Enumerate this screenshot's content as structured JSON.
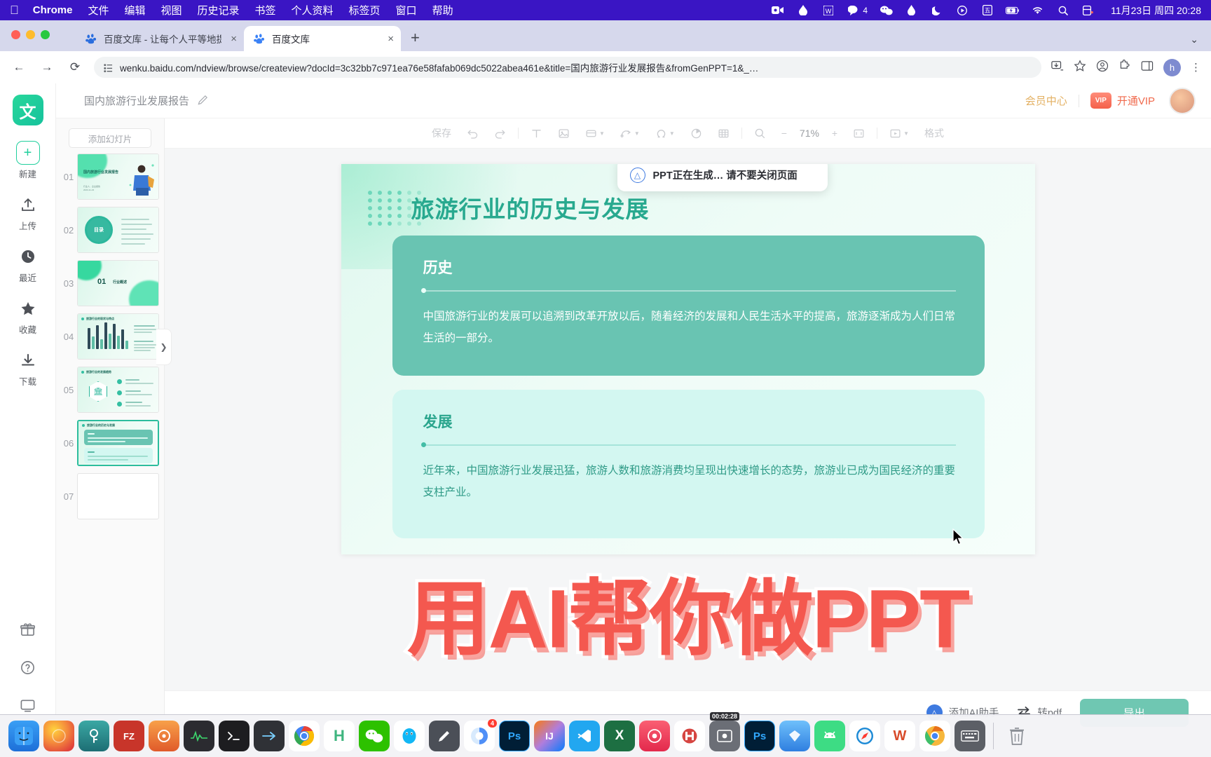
{
  "macbar": {
    "apple_icon": "apple-logo-icon",
    "items": [
      "Chrome",
      "文件",
      "编辑",
      "视图",
      "历史记录",
      "书签",
      "个人资料",
      "标签页",
      "窗口",
      "帮助"
    ],
    "tray": [
      {
        "name": "camera-recorder-icon"
      },
      {
        "name": "drop-icon"
      },
      {
        "name": "wolfram-w-icon"
      },
      {
        "name": "chat-bubble-icon",
        "badge": "4"
      },
      {
        "name": "wechat-icon"
      },
      {
        "name": "water-drop-icon"
      },
      {
        "name": "moon-icon"
      },
      {
        "name": "play-circle-icon"
      },
      {
        "name": "input-method-icon"
      },
      {
        "name": "battery-charging-icon"
      },
      {
        "name": "wifi-icon"
      },
      {
        "name": "spotlight-search-icon"
      },
      {
        "name": "control-center-icon"
      }
    ],
    "clock": "11月23日 周四 20:28"
  },
  "browser": {
    "tabs": [
      {
        "title": "百度文库 - 让每个人平等地提升",
        "active": false,
        "favicon": "baidu-paw-icon",
        "close": "×"
      },
      {
        "title": "百度文库",
        "active": true,
        "favicon": "baidu-paw-icon",
        "close": "×"
      }
    ],
    "new_tab_label": "+",
    "tabstrip_chevron": "⌄",
    "nav": {
      "back": "←",
      "forward": "→",
      "reload": "⟳"
    },
    "url": "wenku.baidu.com/ndview/browse/createview?docId=3c32bb7c971ea76e58fafab069dc5022abea461e&title=国内旅游行业发展报告&fromGenPPT=1&_…",
    "url_prefix_icon": "site-settings-icon",
    "right_icons": [
      "install-app-icon",
      "bookmark-star-icon",
      "profile-circle-icon",
      "extensions-icon",
      "side-panel-icon"
    ],
    "profile_initial": "h",
    "menu_icon": "kebab-menu-icon"
  },
  "app": {
    "logo_char": "文",
    "doc_title": "国内旅游行业发展报告",
    "edit_icon": "pencil-icon",
    "member_center": "会员中心",
    "vip_badge": "VIP",
    "open_vip": "开通VIP"
  },
  "rail": {
    "items": [
      {
        "label": "新建",
        "icon": "plus-icon",
        "glyph": "+"
      },
      {
        "label": "上传",
        "icon": "upload-icon",
        "glyph": "⬆"
      },
      {
        "label": "最近",
        "icon": "clock-icon",
        "glyph": "🕐"
      },
      {
        "label": "收藏",
        "icon": "star-icon",
        "glyph": "★"
      },
      {
        "label": "下载",
        "icon": "download-icon",
        "glyph": "⬇"
      }
    ],
    "bottom": [
      {
        "icon": "gift-icon",
        "glyph": "🎁"
      },
      {
        "icon": "help-circle-icon",
        "glyph": "?"
      },
      {
        "icon": "monitor-icon",
        "glyph": "🖥"
      }
    ]
  },
  "thumbnails": {
    "add_slide_label": "添加幻灯片",
    "collapse_chevron": "❯",
    "slides": [
      {
        "num": "01",
        "kind": "cover",
        "title": "国内旅游行业发展报告",
        "selected": false
      },
      {
        "num": "02",
        "kind": "toc",
        "title": "目录",
        "selected": false
      },
      {
        "num": "03",
        "kind": "section",
        "title": "01 行业概述",
        "selected": false
      },
      {
        "num": "04",
        "kind": "chart",
        "title": "旅游行业的现状与特点",
        "selected": false
      },
      {
        "num": "05",
        "kind": "icons",
        "title": "旅游行业的发展趋势",
        "selected": false
      },
      {
        "num": "06",
        "kind": "cards",
        "title": "旅游行业的历史与发展",
        "selected": true
      },
      {
        "num": "07",
        "kind": "blank",
        "title": "",
        "selected": false
      }
    ]
  },
  "toolbar": {
    "save_label": "保存",
    "undo_icon": "undo-icon",
    "redo_icon": "redo-icon",
    "text_icon": "text-T-icon",
    "image_icon": "image-icon",
    "shape_icon": "shape-icon",
    "connector_icon": "connector-icon",
    "symbol_icon": "omega-symbol-icon",
    "chart_icon": "pie-chart-icon",
    "table_icon": "table-icon",
    "search_icon": "search-icon",
    "zoom_out": "−",
    "zoom_value": "71%",
    "zoom_in": "+",
    "fit_icon": "fit-screen-icon",
    "present_icon": "present-icon",
    "format_label": "格式"
  },
  "toast": {
    "icon": "ai-triangle-icon",
    "text": "PPT正在生成… 请不要关闭页面"
  },
  "slide": {
    "title": "旅游行业的历史与发展",
    "cards": [
      {
        "heading": "历史",
        "body": "中国旅游行业的发展可以追溯到改革开放以后，随着经济的发展和人民生活水平的提高，旅游逐渐成为人们日常生活的一部分。"
      },
      {
        "heading": "发展",
        "body": "近年来，中国旅游行业发展迅猛，旅游人数和旅游消费均呈现出快速增长的态势，旅游业已成为国民经济的重要支柱产业。"
      }
    ]
  },
  "watermark": "用AI帮你做PPT",
  "bottombar": {
    "ai_assistant": "添加AI助手",
    "ai_icon": "ai-triangle-icon",
    "convert_pdf": "转pdf",
    "convert_icon": "swap-arrows-icon",
    "export": "导出"
  },
  "dock": {
    "apps": [
      {
        "name": "finder",
        "glyph": "◉",
        "color": "#3a9ff5"
      },
      {
        "name": "firefox",
        "glyph": "🦊",
        "color": "#f4893c"
      },
      {
        "name": "keychain",
        "glyph": "◆",
        "color": "#2f8f8d"
      },
      {
        "name": "filezilla",
        "glyph": "FZ",
        "color": "#c8352a"
      },
      {
        "name": "safari-tech",
        "glyph": "◎",
        "color": "#e86a33"
      },
      {
        "name": "activity-monitor",
        "glyph": "∿",
        "color": "#2b2b30"
      },
      {
        "name": "terminal",
        "glyph": ">_",
        "color": "#1d1d20"
      },
      {
        "name": "shuttle",
        "glyph": "➤",
        "color": "#2f3136"
      },
      {
        "name": "chrome",
        "glyph": "◉",
        "color": "#4285f4"
      },
      {
        "name": "highlight-h",
        "glyph": "H",
        "color": "#3fb57f"
      },
      {
        "name": "wechat",
        "glyph": "💬",
        "color": "#2dc100"
      },
      {
        "name": "qq",
        "glyph": "🐧",
        "color": "#12b7f5"
      },
      {
        "name": "notes",
        "glyph": "✎",
        "color": "#4b4f57"
      },
      {
        "name": "preview",
        "glyph": "◐",
        "color": "#4f8ff7",
        "badge": "4"
      },
      {
        "name": "photoshop",
        "glyph": "PS",
        "color": "#001e36"
      },
      {
        "name": "intellij-idea",
        "glyph": "IJ",
        "color": "#2b2b31"
      },
      {
        "name": "vscode",
        "glyph": "✖",
        "color": "#22a7f0"
      },
      {
        "name": "excel",
        "glyph": "X",
        "color": "#1d6f42"
      },
      {
        "name": "xmind",
        "glyph": "◍",
        "color": "#e34a6f"
      },
      {
        "name": "handbrake",
        "glyph": "⦀",
        "color": "#d64541"
      },
      {
        "name": "screen-recorder",
        "glyph": "▣",
        "color": "#6b6e76",
        "timer": "00:02:28"
      },
      {
        "name": "photoshop-2",
        "glyph": "PS",
        "color": "#001e36"
      },
      {
        "name": "sketch",
        "glyph": "◈",
        "color": "#4a90e2"
      },
      {
        "name": "android-studio",
        "glyph": "🤖",
        "color": "#3ddc84"
      },
      {
        "name": "safari",
        "glyph": "⊙",
        "color": "#1c8ad6"
      },
      {
        "name": "wps",
        "glyph": "W",
        "color": "#d84b2a"
      },
      {
        "name": "chrome-canary",
        "glyph": "◉",
        "color": "#f6b73c"
      },
      {
        "name": "keyboard-settings",
        "glyph": "⌨",
        "color": "#5c5f66"
      },
      {
        "name": "trash",
        "glyph": "🗑",
        "color": "#9aa0a6"
      }
    ]
  }
}
